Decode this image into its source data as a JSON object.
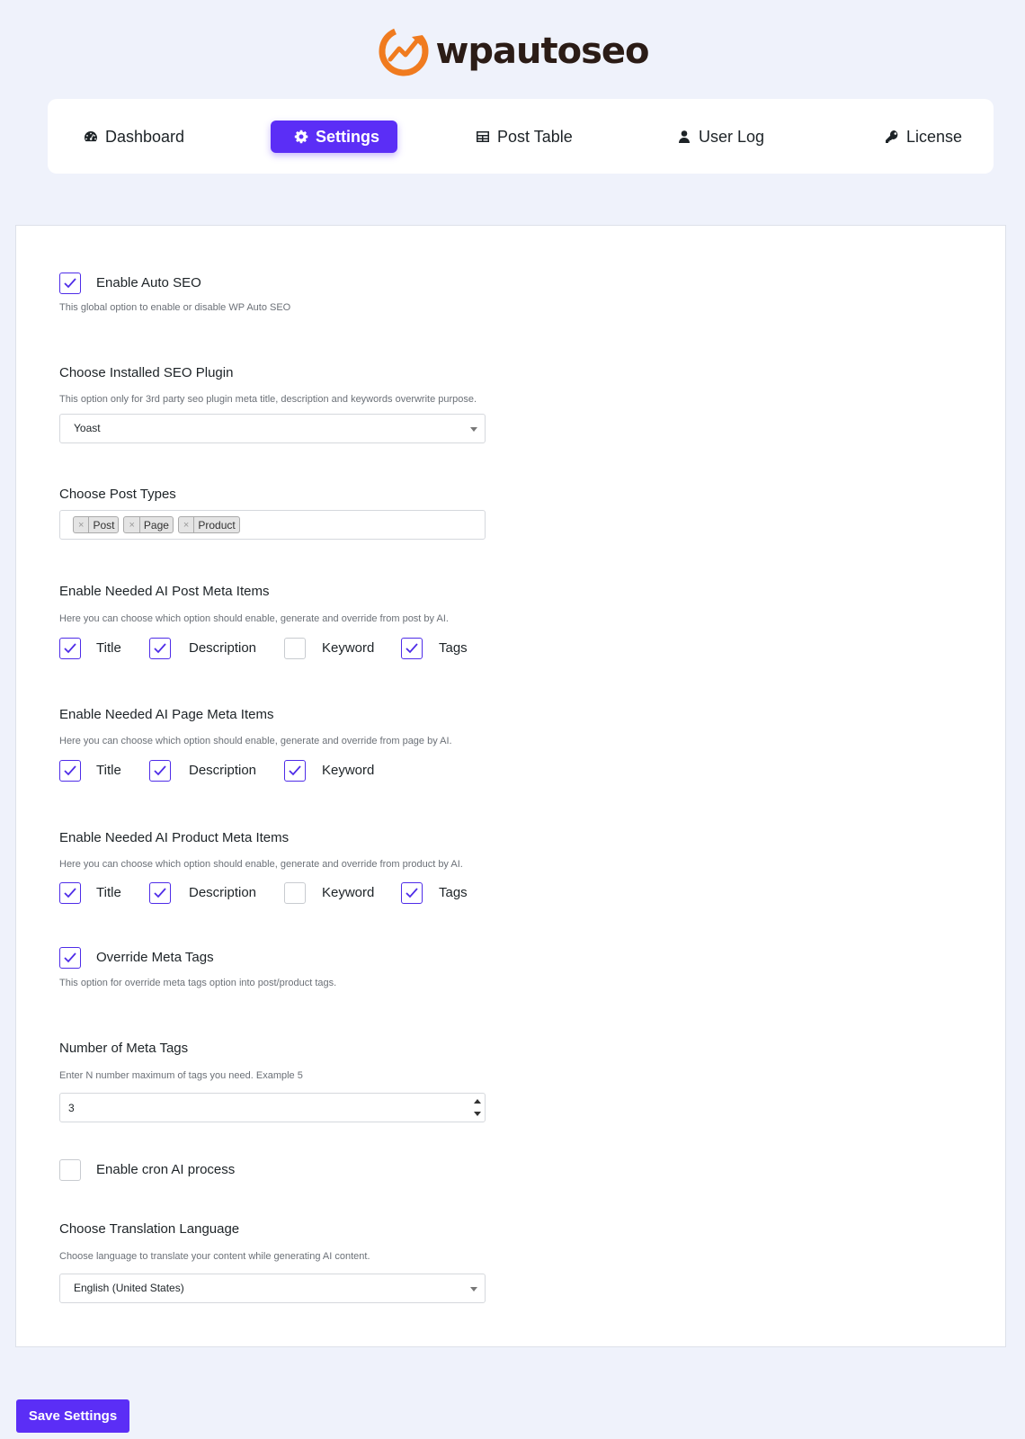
{
  "brand": {
    "name": "wpautoseo",
    "accent": "#5b2ef6",
    "logo_orange": "#f07b1f"
  },
  "nav": {
    "items": [
      {
        "label": "Dashboard",
        "icon": "tachometer-icon",
        "active": false
      },
      {
        "label": "Settings",
        "icon": "gear-icon",
        "active": true
      },
      {
        "label": "Post Table",
        "icon": "table-icon",
        "active": false
      },
      {
        "label": "User Log",
        "icon": "user-icon",
        "active": false
      },
      {
        "label": "License",
        "icon": "key-icon",
        "active": false
      }
    ]
  },
  "settings": {
    "enable_auto_seo": {
      "label": "Enable Auto SEO",
      "checked": true,
      "desc": "This global option to enable or disable WP Auto SEO"
    },
    "seo_plugin": {
      "heading": "Choose Installed SEO Plugin",
      "desc": "This option only for 3rd party seo plugin meta title, description and keywords overwrite purpose.",
      "value": "Yoast"
    },
    "post_types": {
      "heading": "Choose Post Types",
      "tags": [
        "Post",
        "Page",
        "Product"
      ],
      "remove_glyph": "×"
    },
    "post_meta": {
      "heading": "Enable Needed AI Post Meta Items",
      "desc": "Here you can choose which option should enable, generate and override from post by AI.",
      "items": [
        {
          "label": "Title",
          "checked": true
        },
        {
          "label": "Description",
          "checked": true
        },
        {
          "label": "Keyword",
          "checked": false
        },
        {
          "label": "Tags",
          "checked": true
        }
      ]
    },
    "page_meta": {
      "heading": "Enable Needed AI Page Meta Items",
      "desc": "Here you can choose which option should enable, generate and override from page by AI.",
      "items": [
        {
          "label": "Title",
          "checked": true
        },
        {
          "label": "Description",
          "checked": true
        },
        {
          "label": "Keyword",
          "checked": true
        }
      ]
    },
    "product_meta": {
      "heading": "Enable Needed AI Product Meta Items",
      "desc": "Here you can choose which option should enable, generate and override from product by AI.",
      "items": [
        {
          "label": "Title",
          "checked": true
        },
        {
          "label": "Description",
          "checked": true
        },
        {
          "label": "Keyword",
          "checked": false
        },
        {
          "label": "Tags",
          "checked": true
        }
      ]
    },
    "override_meta_tags": {
      "label": "Override Meta Tags",
      "checked": true,
      "desc": "This option for override meta tags option into post/product tags."
    },
    "num_meta_tags": {
      "heading": "Number of Meta Tags",
      "desc": "Enter N number maximum of tags you need. Example 5",
      "value": "3"
    },
    "cron": {
      "label": "Enable cron AI process",
      "checked": false
    },
    "translation": {
      "heading": "Choose Translation Language",
      "desc": "Choose language to translate your content while generating AI content.",
      "value": "English (United States)"
    }
  },
  "save_button": {
    "label": "Save Settings"
  }
}
